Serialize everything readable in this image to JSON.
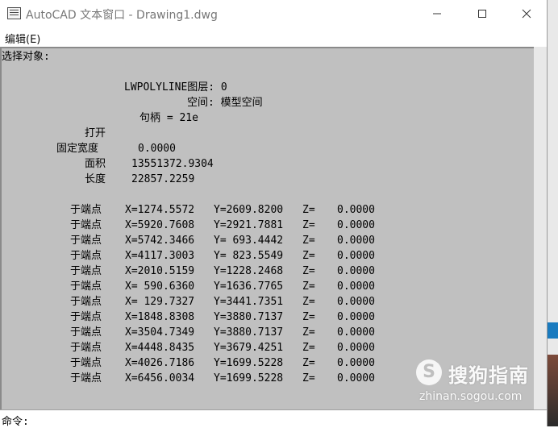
{
  "window": {
    "title": "AutoCAD 文本窗口 - Drawing1.dwg"
  },
  "menu": {
    "edit": "编辑(E)"
  },
  "output": {
    "prompt": "选择对象:",
    "entity": "LWPOLYLINE图层: 0",
    "space": "空间: 模型空间",
    "handle": "句柄 = 21e",
    "status": "打开",
    "fixed_width_label": "固定宽度",
    "fixed_width_value": "0.0000",
    "area_label": "面积",
    "area_value": "13551372.9304",
    "length_label": "长度",
    "length_value": "22857.2259",
    "vertices": [
      {
        "label": "于端点",
        "x": "X=1274.5572",
        "y": "Y=2609.8200",
        "z_label": "Z=",
        "z": "0.0000"
      },
      {
        "label": "于端点",
        "x": "X=5920.7608",
        "y": "Y=2921.7881",
        "z_label": "Z=",
        "z": "0.0000"
      },
      {
        "label": "于端点",
        "x": "X=5742.3466",
        "y": "Y= 693.4442",
        "z_label": "Z=",
        "z": "0.0000"
      },
      {
        "label": "于端点",
        "x": "X=4117.3003",
        "y": "Y= 823.5549",
        "z_label": "Z=",
        "z": "0.0000"
      },
      {
        "label": "于端点",
        "x": "X=2010.5159",
        "y": "Y=1228.2468",
        "z_label": "Z=",
        "z": "0.0000"
      },
      {
        "label": "于端点",
        "x": "X= 590.6360",
        "y": "Y=1636.7765",
        "z_label": "Z=",
        "z": "0.0000"
      },
      {
        "label": "于端点",
        "x": "X= 129.7327",
        "y": "Y=3441.7351",
        "z_label": "Z=",
        "z": "0.0000"
      },
      {
        "label": "于端点",
        "x": "X=1848.8308",
        "y": "Y=3880.7137",
        "z_label": "Z=",
        "z": "0.0000"
      },
      {
        "label": "于端点",
        "x": "X=3504.7349",
        "y": "Y=3880.7137",
        "z_label": "Z=",
        "z": "0.0000"
      },
      {
        "label": "于端点",
        "x": "X=4448.8435",
        "y": "Y=3679.4251",
        "z_label": "Z=",
        "z": "0.0000"
      },
      {
        "label": "于端点",
        "x": "X=4026.7186",
        "y": "Y=1699.5228",
        "z_label": "Z=",
        "z": "0.0000"
      },
      {
        "label": "于端点",
        "x": "X=6456.0034",
        "y": "Y=1699.5228",
        "z_label": "Z=",
        "z": "0.0000"
      }
    ]
  },
  "command": {
    "label": "命令:"
  },
  "watermark": {
    "brand": "搜狗指南",
    "url": "zhinan.sogou.com",
    "logo": "S"
  }
}
